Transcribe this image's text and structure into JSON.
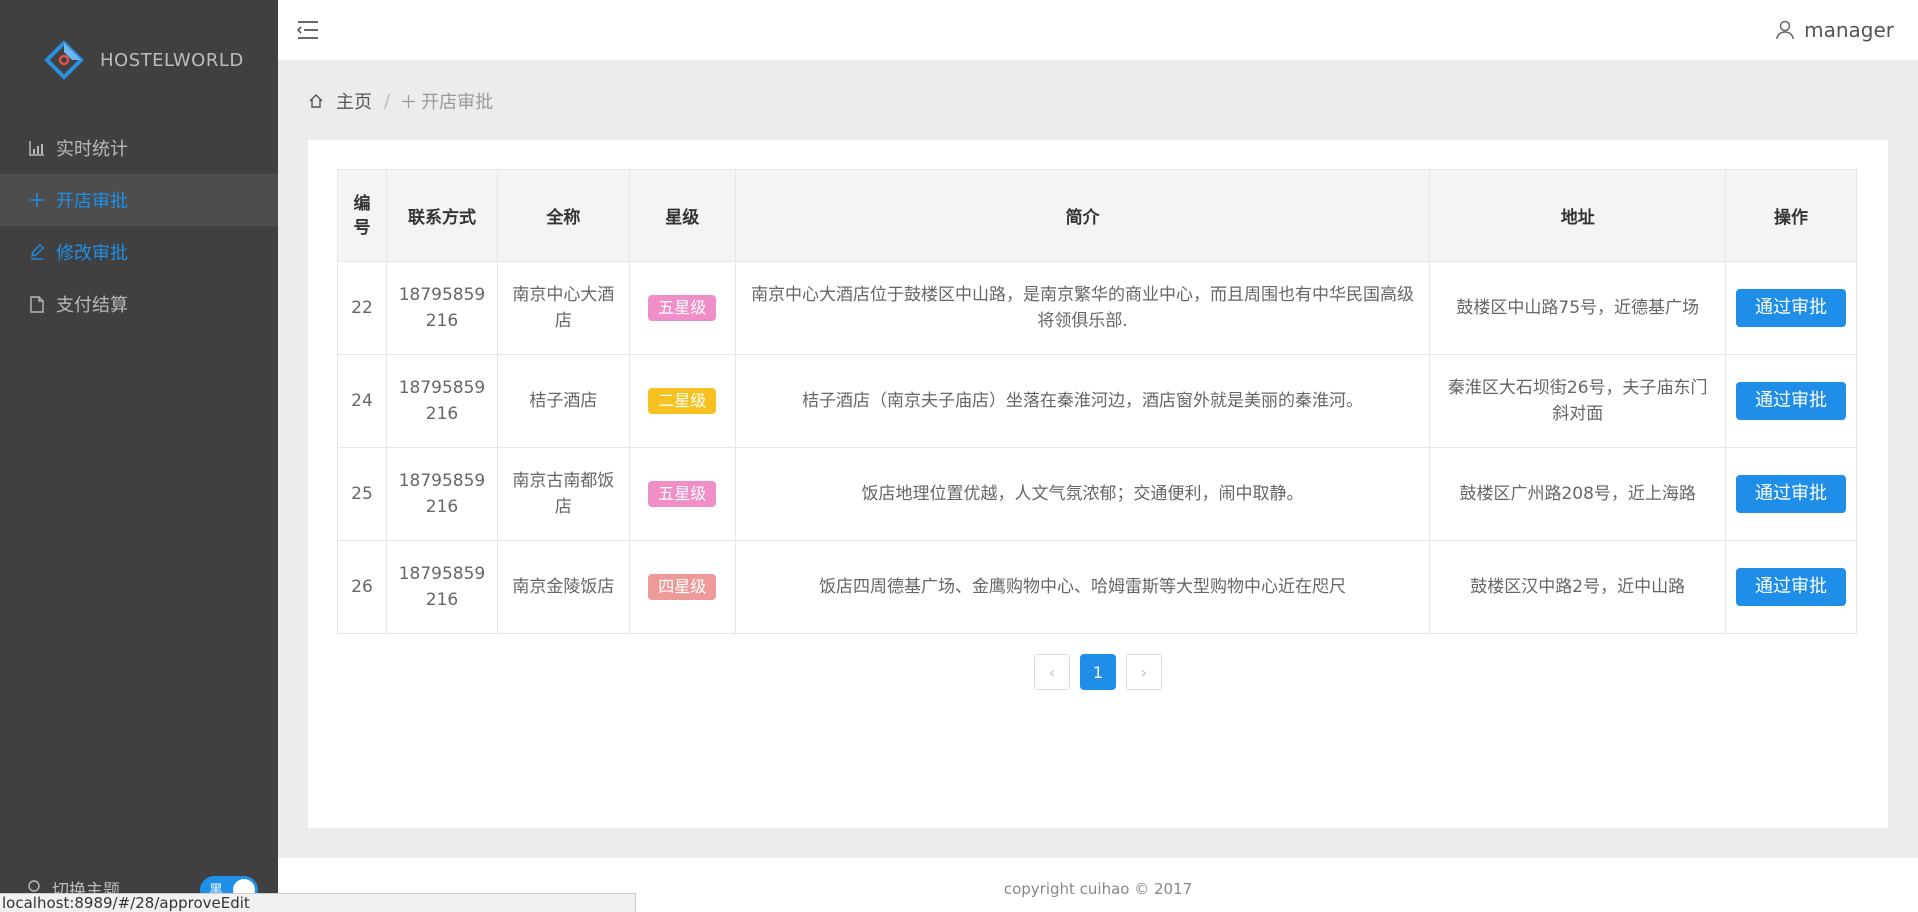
{
  "app": {
    "brand": "HOSTELWORLD"
  },
  "sidebar": {
    "items": [
      {
        "label": "实时统计",
        "icon": "chart-icon"
      },
      {
        "label": "开店审批",
        "icon": "plus-icon"
      },
      {
        "label": "修改审批",
        "icon": "edit-icon"
      },
      {
        "label": "支付结算",
        "icon": "file-icon"
      }
    ],
    "theme_label": "切换主题",
    "theme_toggle_text": "黑"
  },
  "header": {
    "user": "manager"
  },
  "breadcrumb": {
    "home": "主页",
    "current": "开店审批"
  },
  "table": {
    "headers": [
      "编号",
      "联系方式",
      "全称",
      "星级",
      "简介",
      "地址",
      "操作"
    ],
    "rows": [
      {
        "id": "22",
        "phone": "18795859216",
        "name": "南京中心大酒店",
        "star": "五星级",
        "star_color": "#f08ec8",
        "intro": "南京中心大酒店位于鼓楼区中山路，是南京繁华的商业中心，而且周围也有中华民国高级将领俱乐部.",
        "address": "鼓楼区中山路75号，近德基广场",
        "action": "通过审批"
      },
      {
        "id": "24",
        "phone": "18795859216",
        "name": "桔子酒店",
        "star": "二星级",
        "star_color": "#f7c21f",
        "intro": "桔子酒店（南京夫子庙店）坐落在秦淮河边，酒店窗外就是美丽的秦淮河。",
        "address": "秦淮区大石坝街26号，夫子庙东门斜对面",
        "action": "通过审批"
      },
      {
        "id": "25",
        "phone": "18795859216",
        "name": "南京古南都饭店",
        "star": "五星级",
        "star_color": "#f08ec8",
        "intro": "饭店地理位置优越，人文气氛浓郁；交通便利，闹中取静。",
        "address": "鼓楼区广州路208号，近上海路",
        "action": "通过审批"
      },
      {
        "id": "26",
        "phone": "18795859216",
        "name": "南京金陵饭店",
        "star": "四星级",
        "star_color": "#ef9a9a",
        "intro": "饭店四周德基广场、金鹰购物中心、哈姆雷斯等大型购物中心近在咫尺",
        "address": "鼓楼区汉中路2号，近中山路",
        "action": "通过审批"
      }
    ]
  },
  "pagination": {
    "prev": "‹",
    "current": "1",
    "next": "›"
  },
  "footer": {
    "text": "copyright cuihao © 2017"
  },
  "statusbar": {
    "url": "localhost:8989/#/28/approveEdit"
  },
  "colors": {
    "accent": "#1e8ee8",
    "sidebar_bg": "#404040"
  }
}
